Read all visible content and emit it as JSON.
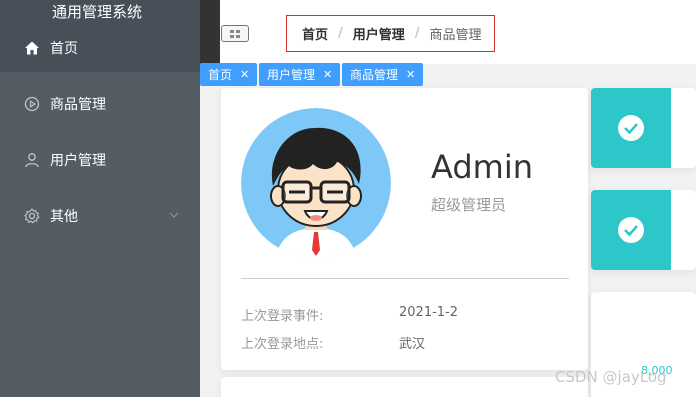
{
  "app": {
    "title": "通用管理系统"
  },
  "sidebar": {
    "items": [
      {
        "label": "首页",
        "icon": "home-icon"
      },
      {
        "label": "商品管理",
        "icon": "play-circle-icon"
      },
      {
        "label": "用户管理",
        "icon": "user-icon"
      },
      {
        "label": "其他",
        "icon": "gear-icon"
      }
    ],
    "colors": {
      "bg": "#545c64",
      "text": "#ffffff"
    }
  },
  "header": {
    "breadcrumb": [
      "首页",
      "用户管理",
      "商品管理"
    ]
  },
  "tags": [
    {
      "label": "首页"
    },
    {
      "label": "用户管理"
    },
    {
      "label": "商品管理"
    }
  ],
  "user": {
    "name": "Admin",
    "role": "超级管理员",
    "last_login_time_label": "上次登录事件:",
    "last_login_time": "2021-1-2",
    "last_login_place_label": "上次登录地点:",
    "last_login_place": "武汉"
  },
  "chart": {
    "tick": "8,000"
  },
  "watermark": "CSDN @jayLog",
  "colors": {
    "accent": "#409eff",
    "stat": "#2ec7c9",
    "breadcrumb_border": "#d32f2f"
  }
}
